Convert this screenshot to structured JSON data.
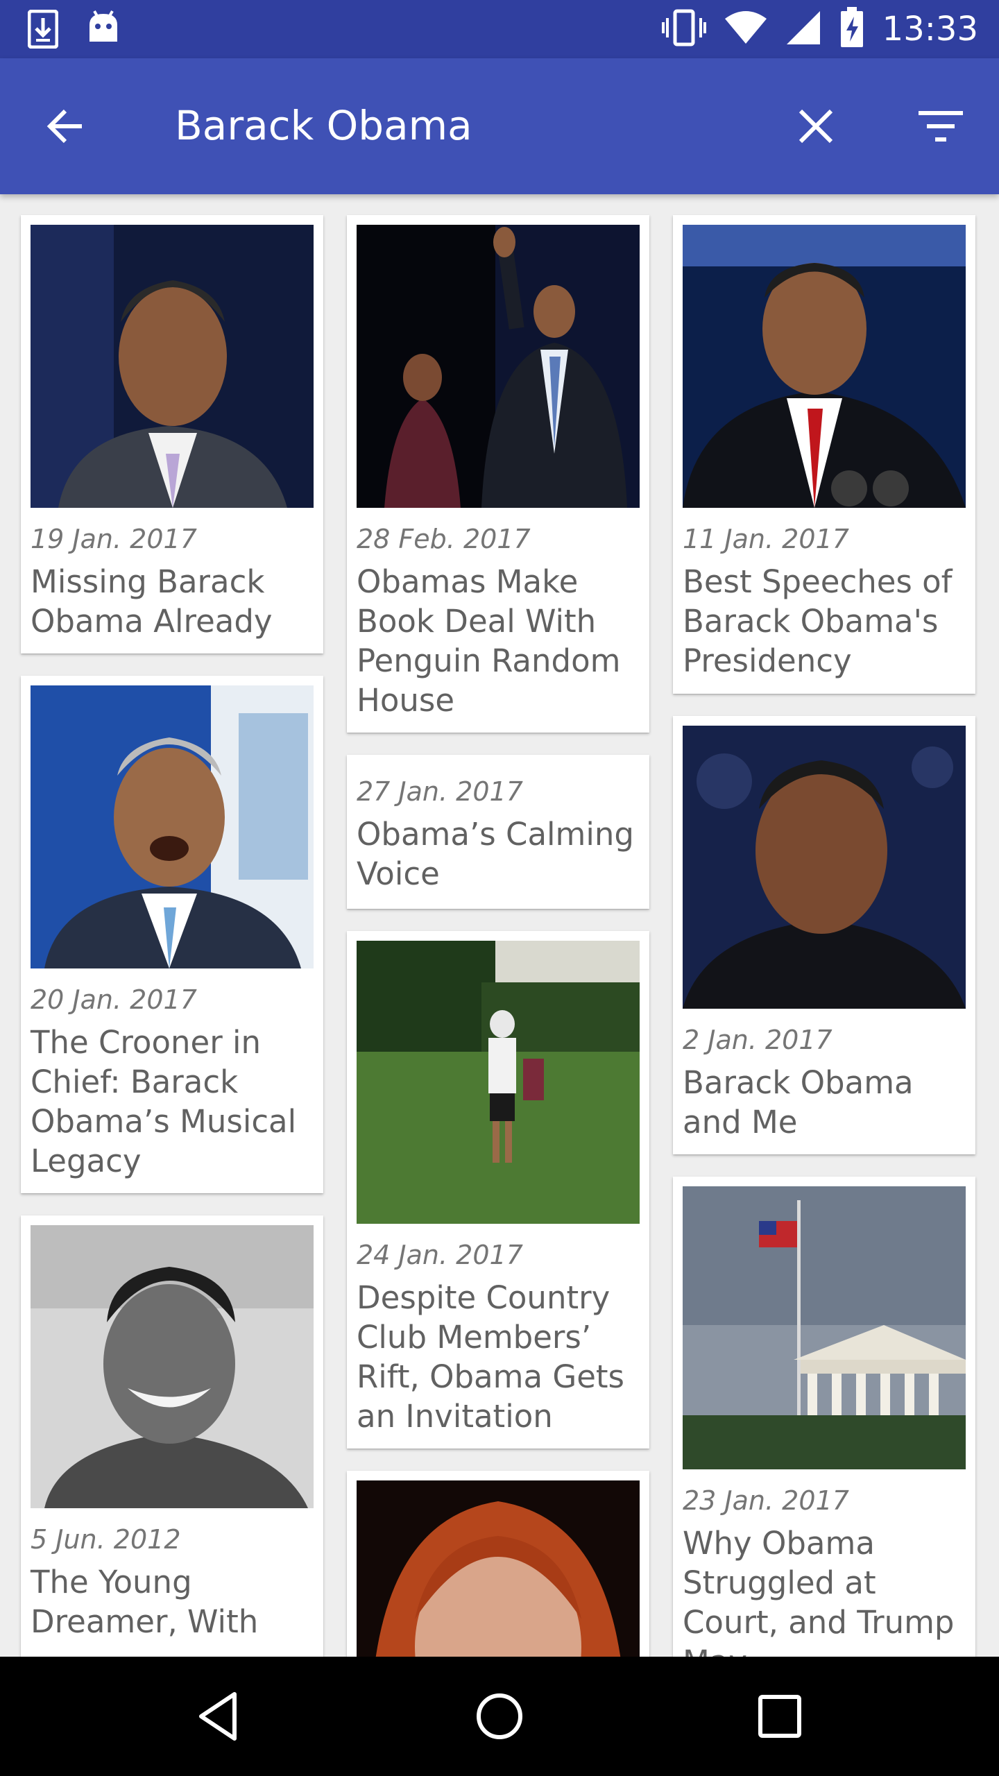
{
  "status_bar": {
    "time": "13:33",
    "icons": [
      "download-icon",
      "android-icon",
      "vibrate-icon",
      "wifi-icon",
      "signal-icon",
      "battery-charging-icon"
    ]
  },
  "app_bar": {
    "back_icon": "arrow-back-icon",
    "search_query": "Barack Obama",
    "clear_icon": "close-icon",
    "filter_icon": "filter-icon"
  },
  "articles": [
    {
      "date": "19 Jan. 2017",
      "title": "Missing Barack Obama Already",
      "image": "portrait-obama-dark-background"
    },
    {
      "date": "28 Feb. 2017",
      "title": "Obamas Make Book Deal With Penguin Random House",
      "image": "obamas-waving-on-stage"
    },
    {
      "date": "11 Jan. 2017",
      "title": "Best Speeches of Barack Obama's Presidency",
      "image": "obama-speech-microphones"
    },
    {
      "date": "20 Jan. 2017",
      "title": "The Crooner in Chief: Barack Obama’s Musical Legacy",
      "image": "obama-singing"
    },
    {
      "date": "27 Jan. 2017",
      "title": "Obama’s Calming Voice",
      "image": ""
    },
    {
      "date": "2 Jan. 2017",
      "title": "Barack Obama and Me",
      "image": "obama-portrait-blue-background"
    },
    {
      "date": "24 Jan. 2017",
      "title": "Despite Country Club Members’ Rift, Obama Gets an Invitation",
      "image": "golfer-walking-on-green"
    },
    {
      "date": "23 Jan. 2017",
      "title": "Why Obama Struggled at Court, and Trump May",
      "image": "supreme-court-building-flag"
    },
    {
      "date": "5 Jun. 2012",
      "title": "The Young Dreamer, With",
      "image": "young-obama-black-white"
    },
    {
      "date": "",
      "title": "",
      "image": "woman-red-hair-portrait"
    }
  ],
  "nav_bar": {
    "icons": [
      "back-triangle-icon",
      "home-circle-icon",
      "recents-square-icon"
    ]
  }
}
